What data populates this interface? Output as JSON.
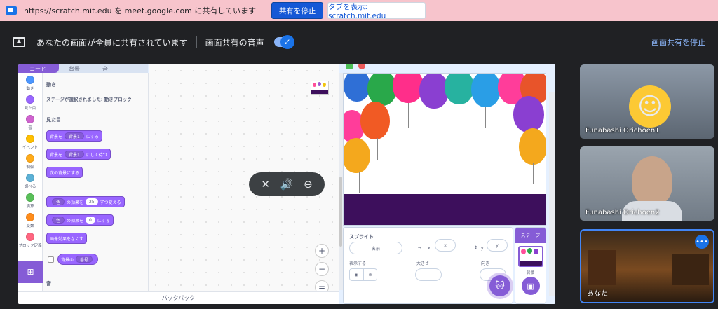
{
  "sharebar": {
    "message": "https://scratch.mit.edu を meet.google.com に共有しています",
    "stop_label": "共有を停止",
    "show_tab_label": "タブを表示: scratch.mit.edu"
  },
  "meetbar": {
    "status": "あなたの画面が全員に共有されています",
    "audio_label": "画面共有の音声",
    "stop_label": "画面共有を停止",
    "audio_enabled": true
  },
  "scratch": {
    "tabs": [
      "コード",
      "背景",
      "音"
    ],
    "categories": [
      {
        "label": "動き",
        "color": "#4c97ff"
      },
      {
        "label": "見た目",
        "color": "#9966ff"
      },
      {
        "label": "音",
        "color": "#cf63cf"
      },
      {
        "label": "イベント",
        "color": "#ffbf00"
      },
      {
        "label": "制御",
        "color": "#ffab19"
      },
      {
        "label": "調べる",
        "color": "#5cb1d6"
      },
      {
        "label": "演算",
        "color": "#59c059"
      },
      {
        "label": "変数",
        "color": "#ff8c1a"
      },
      {
        "label": "ブロック定義",
        "color": "#ff6680"
      }
    ],
    "palette": {
      "motion_header": "動き",
      "motion_note": "ステージが選択されました: 動きブロック",
      "looks_header": "見た目",
      "sound_header": "音",
      "blocks": [
        {
          "a": "背景を",
          "drop": "背景1",
          "b": "にする"
        },
        {
          "a": "背景を",
          "drop": "背景1",
          "b": "にして待つ"
        },
        {
          "a": "次の背景にする"
        },
        {
          "drop": "色",
          "a": "の効果を",
          "num": "25",
          "b": "ずつ変える"
        },
        {
          "drop": "色",
          "a": "の効果を",
          "num": "0",
          "b": "にする"
        },
        {
          "a": "画像効果をなくす"
        },
        {
          "a": "背景の",
          "drop": "番号"
        }
      ]
    },
    "backpack": "バックパック",
    "sprite": {
      "title": "スプライト",
      "name_placeholder": "名前",
      "x_label": "x",
      "y_label": "y",
      "show_label": "表示する",
      "size_label": "大きさ",
      "direction_label": "向き"
    },
    "stage_panel": {
      "header": "ステージ",
      "backdrops_label": "背景"
    }
  },
  "participants": [
    {
      "name": "Funabashi Orichoen1"
    },
    {
      "name": "Funabashi Orichoen2"
    },
    {
      "name": "あなた"
    }
  ]
}
